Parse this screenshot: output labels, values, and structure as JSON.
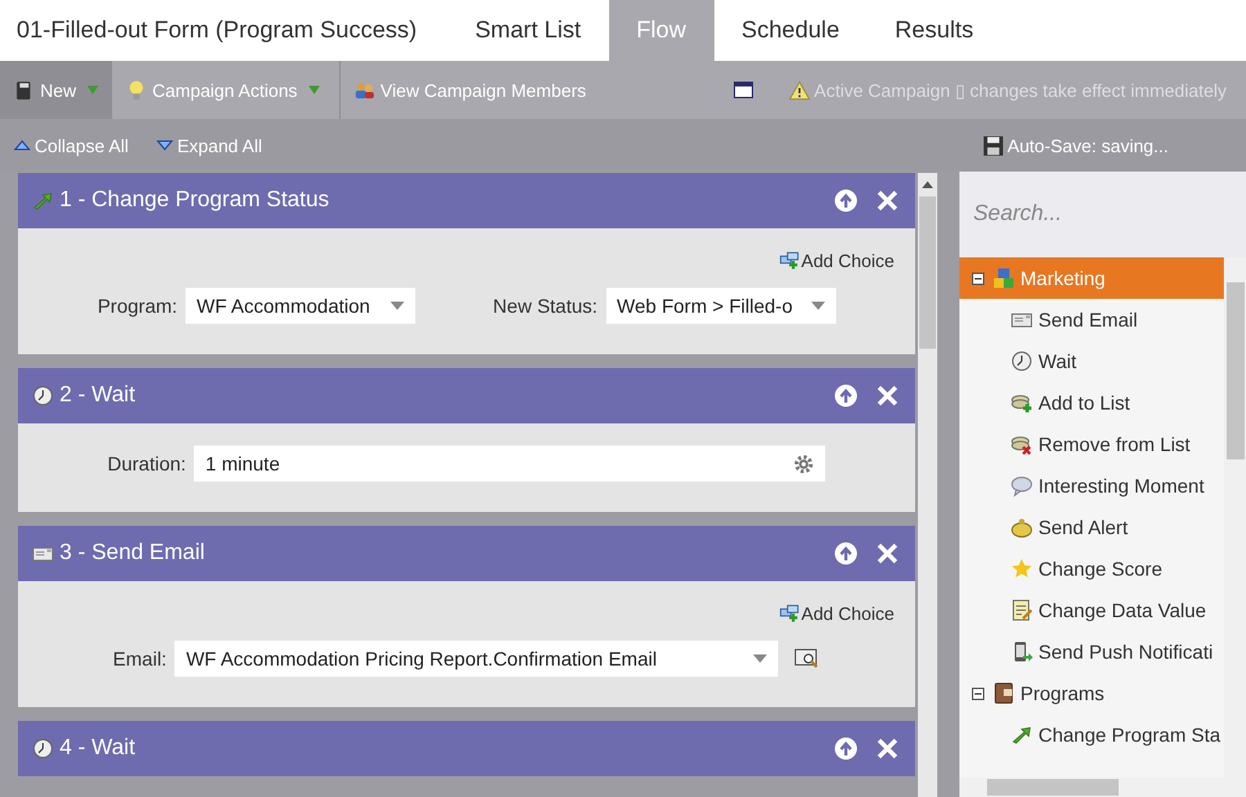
{
  "header": {
    "title": "01-Filled-out Form (Program Success)",
    "tabs": [
      {
        "label": "Smart List",
        "selected": false
      },
      {
        "label": "Flow",
        "selected": true
      },
      {
        "label": "Schedule",
        "selected": false
      },
      {
        "label": "Results",
        "selected": false
      }
    ]
  },
  "toolbar": {
    "new_button": "New",
    "campaign_actions": "Campaign Actions",
    "view_members": "View Campaign Members",
    "notice": "Active Campaign ▯ changes take effect immediately"
  },
  "subtoolbar": {
    "collapse": "Collapse All",
    "expand": "Expand All",
    "autosave": "Auto-Save: saving..."
  },
  "steps": [
    {
      "kind": "status",
      "title": "1 - Change Program Status",
      "add_choice": "Add Choice",
      "fields": [
        {
          "kind": "select",
          "label": "Program:",
          "value": "WF Accommodation"
        },
        {
          "kind": "select",
          "label": "New Status:",
          "value": "Web Form > Filled-o"
        }
      ]
    },
    {
      "kind": "wait",
      "title": "2 - Wait",
      "fields": [
        {
          "kind": "duration",
          "label": "Duration:",
          "value": "1 minute"
        }
      ]
    },
    {
      "kind": "email",
      "title": "3 - Send Email",
      "add_choice": "Add Choice",
      "fields": [
        {
          "kind": "email",
          "label": "Email:",
          "value": "WF Accommodation Pricing Report.Confirmation Email"
        }
      ]
    },
    {
      "kind": "wait",
      "title": "4 - Wait"
    }
  ],
  "palette": {
    "search": {
      "placeholder": "Search..."
    },
    "groups": [
      {
        "kind": "marketing",
        "label": "Marketing",
        "expanded": true,
        "selected": true,
        "children": [
          {
            "kind": "email",
            "label": "Send Email",
            "selected": false
          },
          {
            "kind": "wait",
            "label": "Wait",
            "selected": false
          },
          {
            "kind": "addlist",
            "label": "Add to List",
            "selected": false
          },
          {
            "kind": "removelist",
            "label": "Remove from List",
            "selected": false
          },
          {
            "kind": "moment",
            "label": "Interesting Moment",
            "selected": false
          },
          {
            "kind": "alert",
            "label": "Send Alert",
            "selected": false
          },
          {
            "kind": "score",
            "label": "Change Score",
            "selected": false
          },
          {
            "kind": "data",
            "label": "Change Data Value",
            "selected": false
          },
          {
            "kind": "push",
            "label": "Send Push Notificati",
            "selected": false
          }
        ]
      },
      {
        "kind": "programs",
        "label": "Programs",
        "expanded": true,
        "selected": false,
        "children": [
          {
            "kind": "status",
            "label": "Change Program Sta",
            "selected": false
          }
        ]
      }
    ]
  }
}
